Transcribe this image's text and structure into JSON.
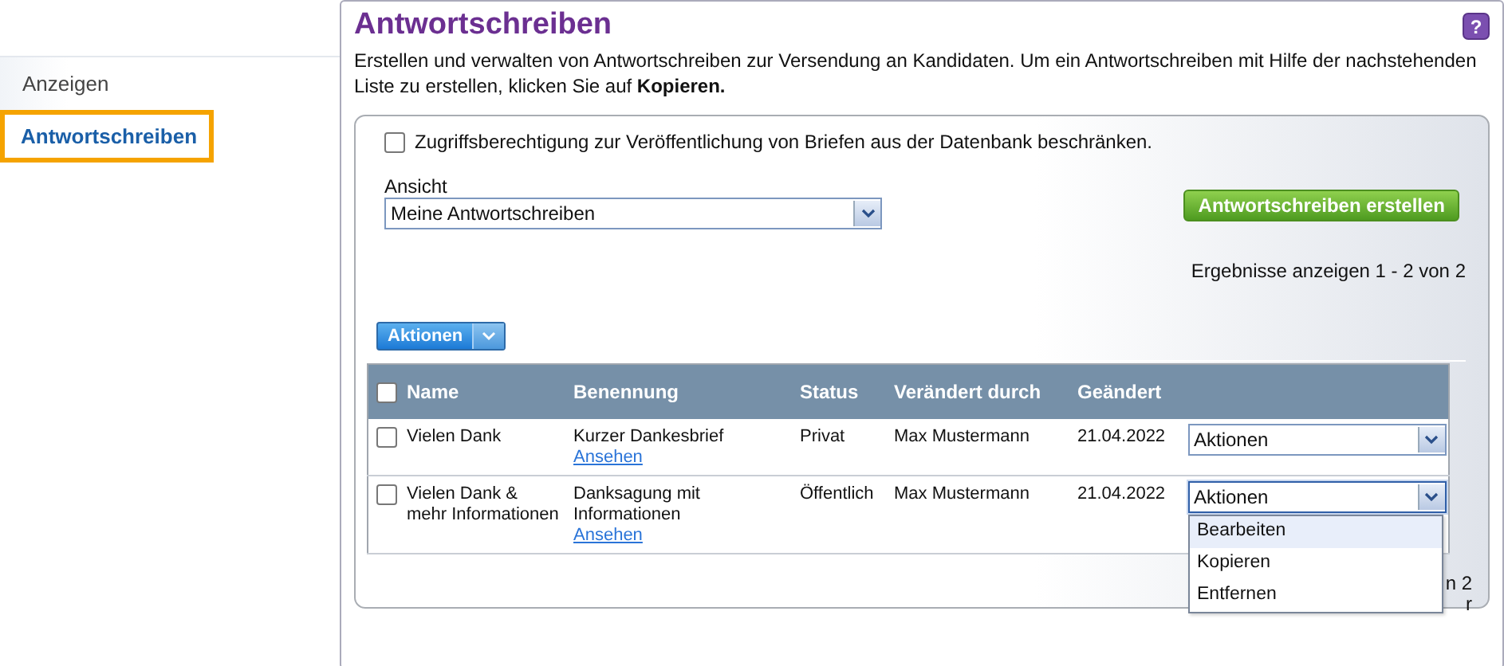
{
  "sidebar": {
    "items": [
      {
        "label": "Anzeigen",
        "selected": false
      },
      {
        "label": "Antwortschreiben",
        "selected": true
      }
    ]
  },
  "page": {
    "title": "Antwortschreiben",
    "help": "?",
    "description": "Erstellen und verwalten von Antwortschreiben zur Versendung an Kandidaten. Um ein Antwortschreiben mit Hilfe der nachstehenden Liste zu erstellen, klicken Sie auf **Kopieren.**"
  },
  "restrict_checkbox": {
    "label": "Zugriffsberechtigung zur Veröffentlichung von Briefen aus der Datenbank beschränken.",
    "checked": false
  },
  "view": {
    "label": "Ansicht",
    "value": "Meine Antwortschreiben"
  },
  "create_button": "Antwortschreiben erstellen",
  "results_text": "Ergebnisse anzeigen 1 - 2 von 2",
  "bulk_actions": "Aktionen",
  "table": {
    "select_all": {
      "checked": false
    },
    "columns": [
      "Name",
      "Benennung",
      "Status",
      "Verändert durch",
      "Geändert"
    ],
    "rows": [
      {
        "checked": false,
        "name": "Vielen Dank",
        "title": "Kurzer Dankesbrief",
        "link": "Ansehen",
        "status": "Privat",
        "changed_by": "Max Mustermann",
        "changed": "21.04.2022",
        "action": "Aktionen",
        "expanded": false
      },
      {
        "checked": false,
        "name": "Vielen Dank & mehr Informationen",
        "title": "Danksagung mit Informationen",
        "link": "Ansehen",
        "status": "Öffentlich",
        "changed_by": "Max Mustermann",
        "changed": "21.04.2022",
        "action": "Aktionen",
        "expanded": true
      }
    ]
  },
  "action_menu": [
    {
      "label": "Bearbeiten",
      "selected": true
    },
    {
      "label": "Kopieren",
      "selected": false
    },
    {
      "label": "Entfernen",
      "selected": false
    }
  ],
  "footer_fragments": [
    "n 2",
    "r"
  ]
}
